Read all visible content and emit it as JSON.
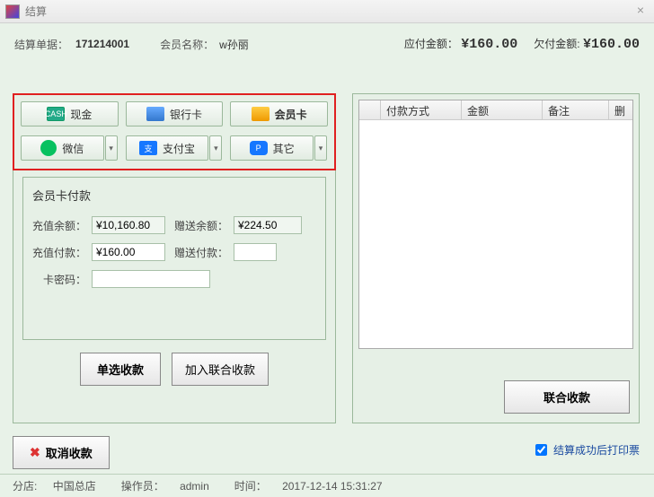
{
  "window": {
    "title": "结算"
  },
  "header": {
    "order_label": "结算单据：",
    "order_no": "171214001",
    "member_label": "会员名称：",
    "member_name": "w孙丽",
    "due_label": "应付金额：",
    "due_amount": "¥160.00",
    "owed_label": "欠付金额:",
    "owed_amount": "¥160.00"
  },
  "pay_methods": {
    "cash": "现金",
    "bank": "银行卡",
    "member": "会员卡",
    "wechat": "微信",
    "alipay": "支付宝",
    "other": "其它"
  },
  "form": {
    "title": "会员卡付款",
    "recharge_balance_label": "充值余额：",
    "recharge_balance": "¥10,160.80",
    "gift_balance_label": "赠送余额：",
    "gift_balance": "¥224.50",
    "recharge_pay_label": "充值付款：",
    "recharge_pay": "¥160.00",
    "gift_pay_label": "赠送付款：",
    "gift_pay": "",
    "card_pwd_label": "卡密码：",
    "card_pwd": ""
  },
  "buttons": {
    "single": "单选收款",
    "join": "加入联合收款",
    "combine": "联合收款",
    "cancel": "取消收款"
  },
  "grid": {
    "cols": [
      "",
      "付款方式",
      "金额",
      "备注",
      "删"
    ]
  },
  "print_label": "结算成功后打印票",
  "status": {
    "store_label": "分店:",
    "store": "中国总店",
    "operator_label": "操作员：",
    "operator": "admin",
    "time_label": "时间：",
    "time": "2017-12-14 15:31:27"
  }
}
